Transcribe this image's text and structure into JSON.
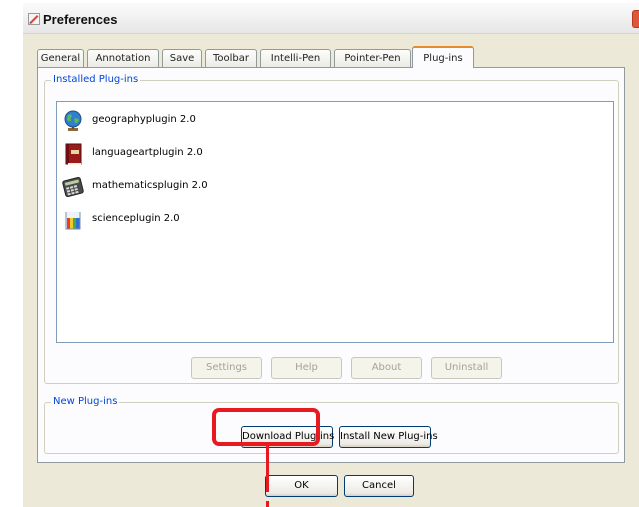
{
  "window": {
    "title": "Preferences",
    "title_icon": "pencil-check-icon",
    "close_icon": "close-icon"
  },
  "tabs": [
    {
      "label": "General"
    },
    {
      "label": "Annotation"
    },
    {
      "label": "Save"
    },
    {
      "label": "Toolbar"
    },
    {
      "label": "Intelli-Pen"
    },
    {
      "label": "Pointer-Pen"
    },
    {
      "label": "Plug-ins",
      "active": true
    }
  ],
  "installed": {
    "group_label": "Installed Plug-ins",
    "items": [
      {
        "label": "geographyplugin 2.0",
        "icon": "globe-icon"
      },
      {
        "label": "languageartplugin 2.0",
        "icon": "book-icon"
      },
      {
        "label": "mathematicsplugin 2.0",
        "icon": "calculator-icon"
      },
      {
        "label": "scienceplugin 2.0",
        "icon": "beaker-icon"
      }
    ],
    "buttons": {
      "settings": "Settings",
      "help": "Help",
      "about": "About",
      "uninstall": "Uninstall"
    }
  },
  "new_plugins": {
    "group_label": "New Plug-ins",
    "download_label": "Download Plug-ins",
    "install_label": "Install New Plug-ins"
  },
  "footer": {
    "ok_label": "OK",
    "cancel_label": "Cancel"
  },
  "colors": {
    "highlight": "#e8191f",
    "active_tab_accent": "#e68b2c",
    "group_label": "#0046d5"
  }
}
